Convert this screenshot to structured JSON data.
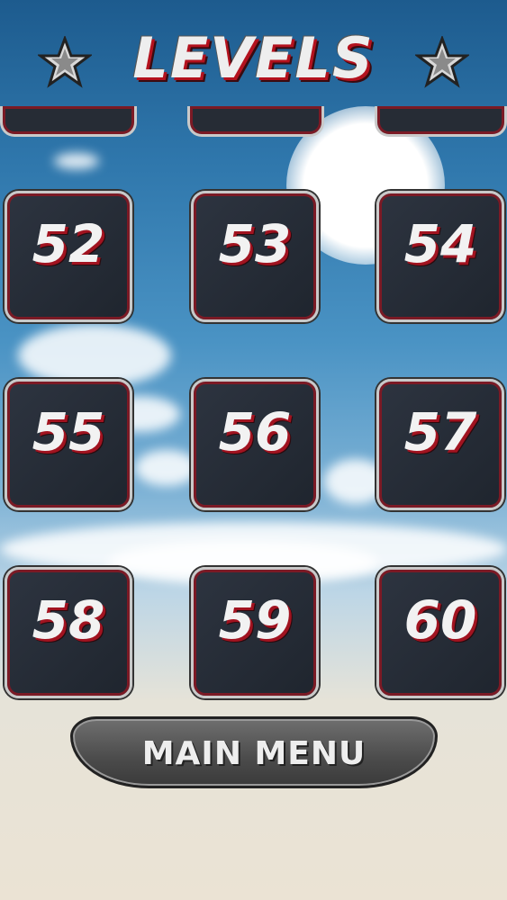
{
  "screen": {
    "title": "LEVELS"
  },
  "levels": [
    "52",
    "53",
    "54",
    "55",
    "56",
    "57",
    "58",
    "59",
    "60"
  ],
  "main_menu": {
    "label": "MAIN MENU"
  },
  "colors": {
    "accent_red": "#b3121e",
    "tile_bg": "#262c35",
    "tile_border": "#c9c9c9"
  },
  "icons": {
    "left": "star-icon",
    "right": "star-icon"
  }
}
